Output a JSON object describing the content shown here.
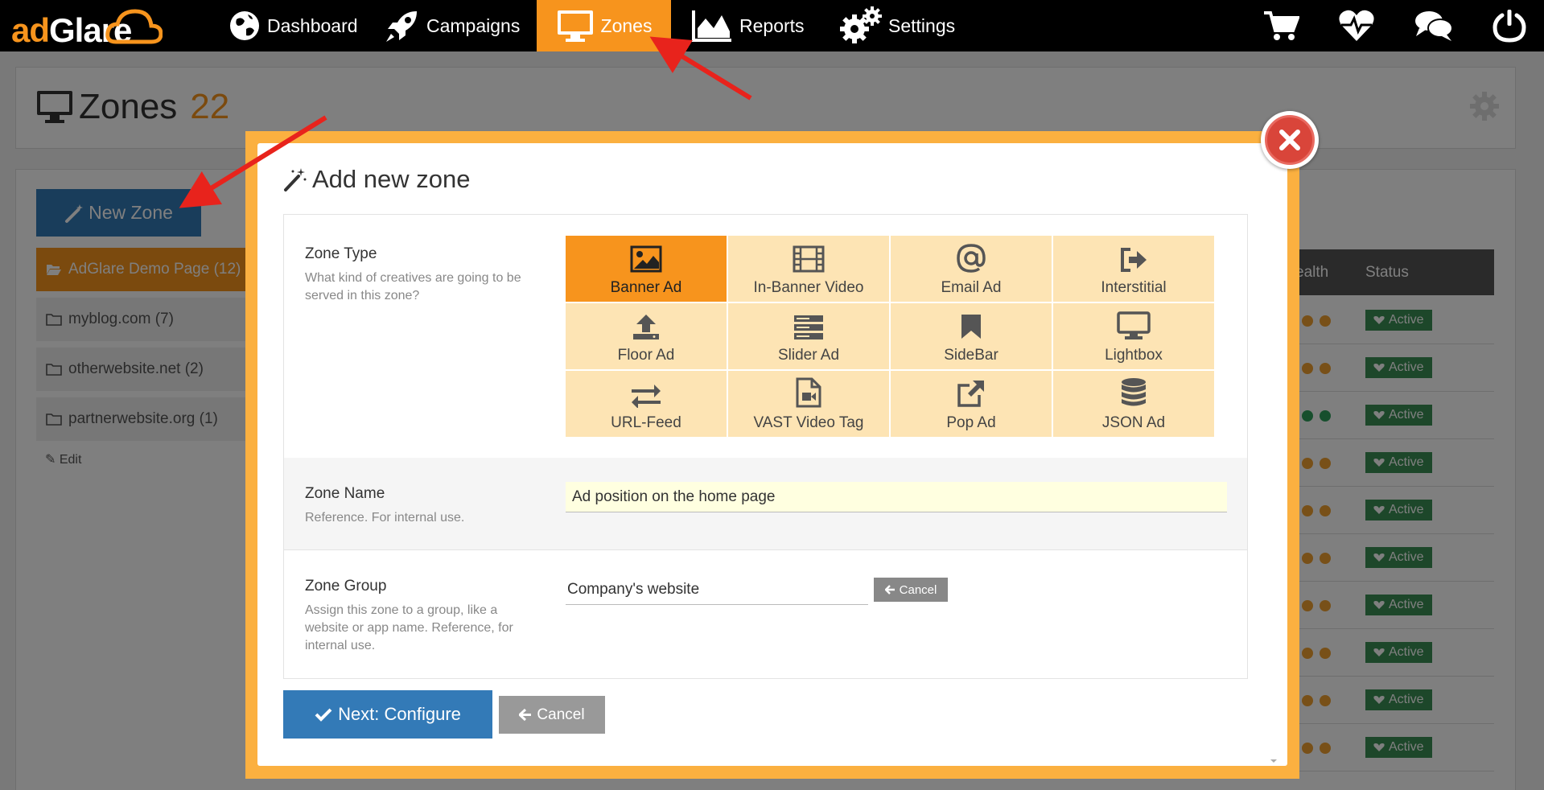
{
  "nav": {
    "logo_ad": "ad",
    "logo_glare": "Glare",
    "items": [
      {
        "label": "Dashboard",
        "icon": "globe-icon"
      },
      {
        "label": "Campaigns",
        "icon": "rocket-icon"
      },
      {
        "label": "Zones",
        "icon": "monitor-icon"
      },
      {
        "label": "Reports",
        "icon": "area-chart-icon"
      },
      {
        "label": "Settings",
        "icon": "gears-icon"
      }
    ],
    "right_icons": [
      "cart-icon",
      "heartbeat-icon",
      "comments-icon",
      "power-icon"
    ],
    "active_color": "#f7941d"
  },
  "page": {
    "title": "Zones",
    "count": "22",
    "new_zone_label": "New Zone",
    "groups": [
      {
        "label": "AdGlare Demo Page (12)",
        "active": true
      },
      {
        "label": "myblog.com (7)",
        "active": false
      },
      {
        "label": "otherwebsite.net (2)",
        "active": false
      },
      {
        "label": "partnerwebsite.org (1)",
        "active": false
      }
    ],
    "edit_label": "Edit",
    "table": {
      "health_header": "ealth",
      "status_header": "Status",
      "status_label": "Active",
      "rows": 10
    }
  },
  "modal": {
    "title": "Add new zone",
    "zone_type": {
      "label": "Zone Type",
      "help": "What kind of creatives are going to be served in this zone?",
      "options": [
        {
          "label": "Banner Ad",
          "icon": "picture-icon",
          "selected": true
        },
        {
          "label": "In-Banner Video",
          "icon": "film-icon",
          "selected": false
        },
        {
          "label": "Email Ad",
          "icon": "at-icon",
          "selected": false
        },
        {
          "label": "Interstitial",
          "icon": "sign-out-icon",
          "selected": false
        },
        {
          "label": "Floor Ad",
          "icon": "upload-icon",
          "selected": false
        },
        {
          "label": "Slider Ad",
          "icon": "server-icon",
          "selected": false
        },
        {
          "label": "SideBar",
          "icon": "bookmark-icon",
          "selected": false
        },
        {
          "label": "Lightbox",
          "icon": "desktop-icon",
          "selected": false
        },
        {
          "label": "URL-Feed",
          "icon": "exchange-icon",
          "selected": false
        },
        {
          "label": "VAST Video Tag",
          "icon": "file-video-icon",
          "selected": false
        },
        {
          "label": "Pop Ad",
          "icon": "external-link-icon",
          "selected": false
        },
        {
          "label": "JSON Ad",
          "icon": "database-icon",
          "selected": false
        }
      ]
    },
    "zone_name": {
      "label": "Zone Name",
      "help": "Reference. For internal use.",
      "value": "Ad position on the home page"
    },
    "zone_group": {
      "label": "Zone Group",
      "help": "Assign this zone to a group, like a website or app name. Reference, for internal use.",
      "value": "Company's website",
      "cancel_label": "Cancel"
    },
    "next_label": "Next: Configure",
    "cancel_label": "Cancel"
  }
}
